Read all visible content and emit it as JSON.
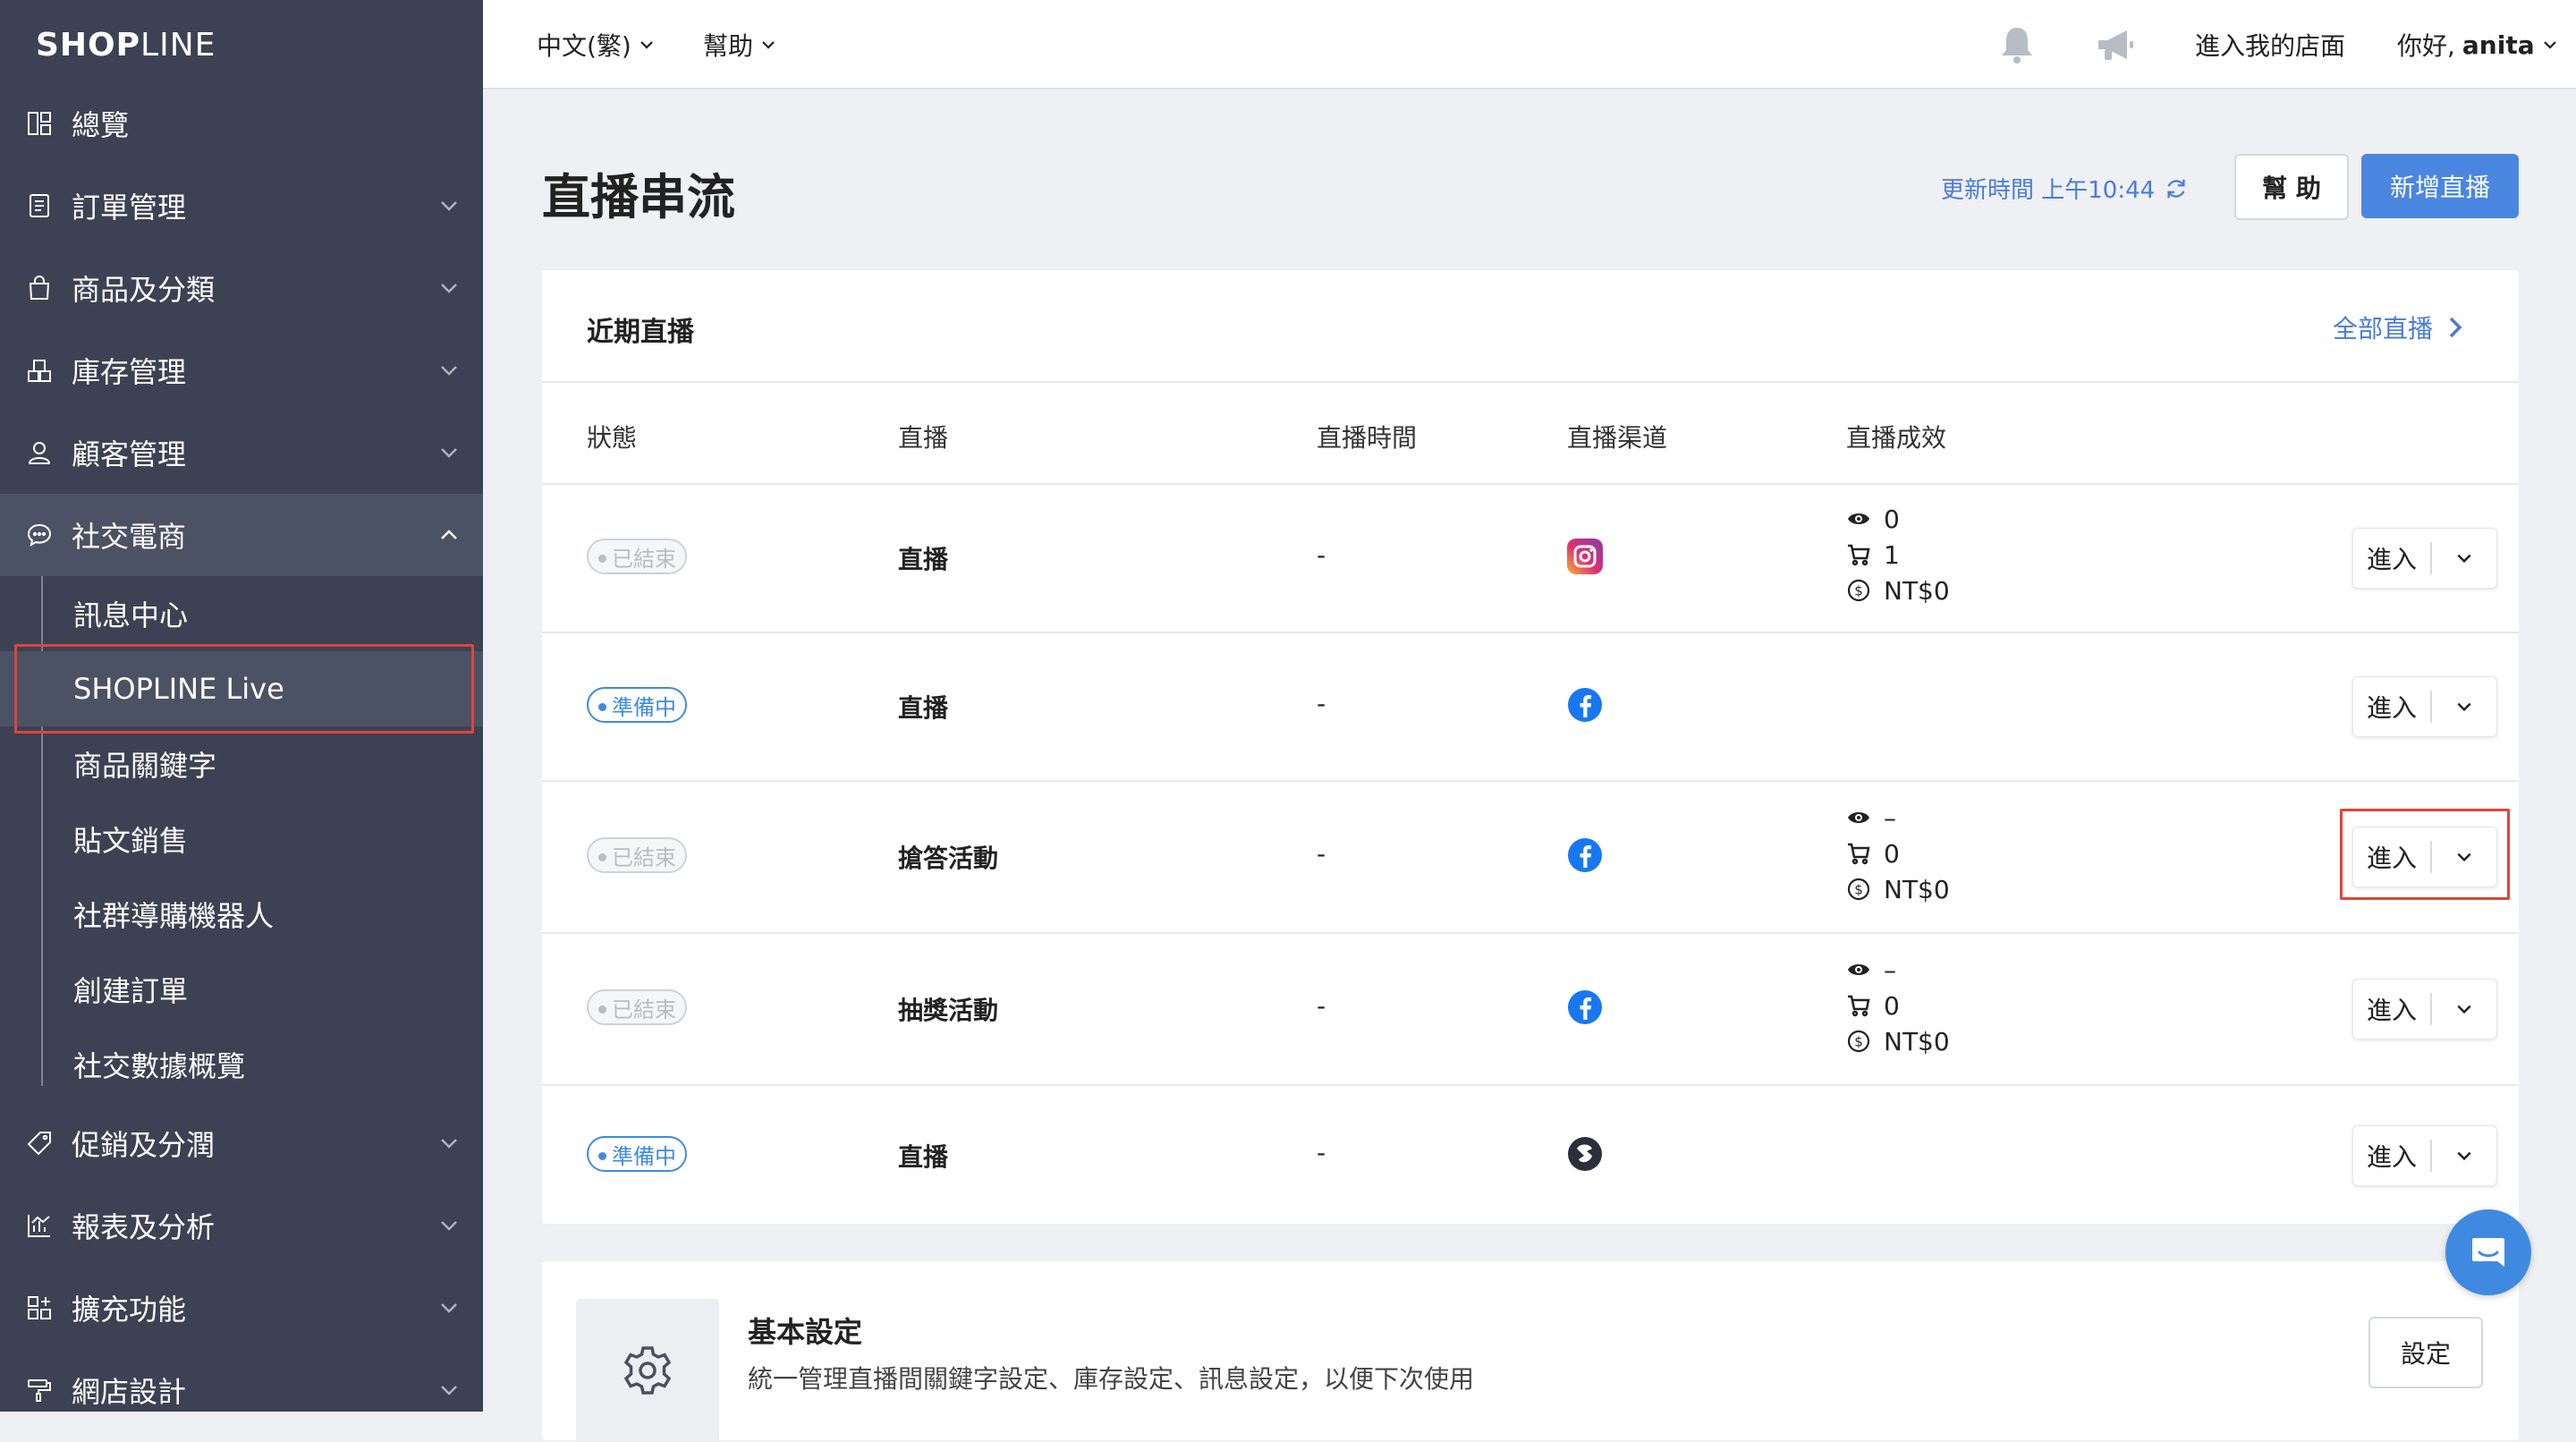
{
  "brand": {
    "logo_bold": "SHOP",
    "logo_light": "LINE"
  },
  "sidebar": {
    "items": [
      {
        "label": "總覽",
        "icon": "dashboard-icon"
      },
      {
        "label": "訂單管理",
        "icon": "orders-icon"
      },
      {
        "label": "商品及分類",
        "icon": "bag-icon"
      },
      {
        "label": "庫存管理",
        "icon": "inventory-icon"
      },
      {
        "label": "顧客管理",
        "icon": "user-icon"
      },
      {
        "label": "社交電商",
        "icon": "chat-icon"
      }
    ],
    "subitems": [
      "訊息中心",
      "SHOPLINE Live",
      "商品關鍵字",
      "貼文銷售",
      "社群導購機器人",
      "創建訂單",
      "社交數據概覽"
    ],
    "items_bottom": [
      {
        "label": "促銷及分潤",
        "icon": "tag-icon"
      },
      {
        "label": "報表及分析",
        "icon": "chart-icon"
      },
      {
        "label": "擴充功能",
        "icon": "apps-icon"
      },
      {
        "label": "網店設計",
        "icon": "brush-icon"
      }
    ]
  },
  "topbar": {
    "language": "中文(繁)",
    "help": "幫助",
    "store_link": "進入我的店面",
    "greeting_prefix": "你好, ",
    "user": "anita"
  },
  "page": {
    "title": "直播串流",
    "updated": "更新時間 上午10:44",
    "help_button": "幫 助",
    "new_button": "新增直播"
  },
  "recent": {
    "title": "近期直播",
    "all_link": "全部直播",
    "columns": [
      "狀態",
      "直播",
      "直播時間",
      "直播渠道",
      "直播成效"
    ],
    "enter_label": "進入",
    "rows": [
      {
        "status": "已結束",
        "status_type": "ended",
        "name": "直播",
        "time": "-",
        "channel": "instagram-icon",
        "views": "0",
        "carts": "1",
        "revenue": "NT$0"
      },
      {
        "status": "準備中",
        "status_type": "prep",
        "name": "直播",
        "time": "-",
        "channel": "facebook-icon",
        "views": "",
        "carts": "",
        "revenue": ""
      },
      {
        "status": "已結束",
        "status_type": "ended",
        "name": "搶答活動",
        "time": "-",
        "channel": "facebook-icon",
        "views": "–",
        "carts": "0",
        "revenue": "NT$0"
      },
      {
        "status": "已結束",
        "status_type": "ended",
        "name": "抽獎活動",
        "time": "-",
        "channel": "facebook-icon",
        "views": "–",
        "carts": "0",
        "revenue": "NT$0"
      },
      {
        "status": "準備中",
        "status_type": "prep",
        "name": "直播",
        "time": "-",
        "channel": "shopline-live-icon",
        "views": "",
        "carts": "",
        "revenue": ""
      }
    ]
  },
  "settings": {
    "title": "基本設定",
    "desc": "統一管理直播間關鍵字設定、庫存設定、訊息設定，以便下次使用",
    "button": "設定"
  },
  "colors": {
    "sidebar": "#3c4253",
    "accent": "#4a86e0",
    "highlight": "#e0443a"
  }
}
